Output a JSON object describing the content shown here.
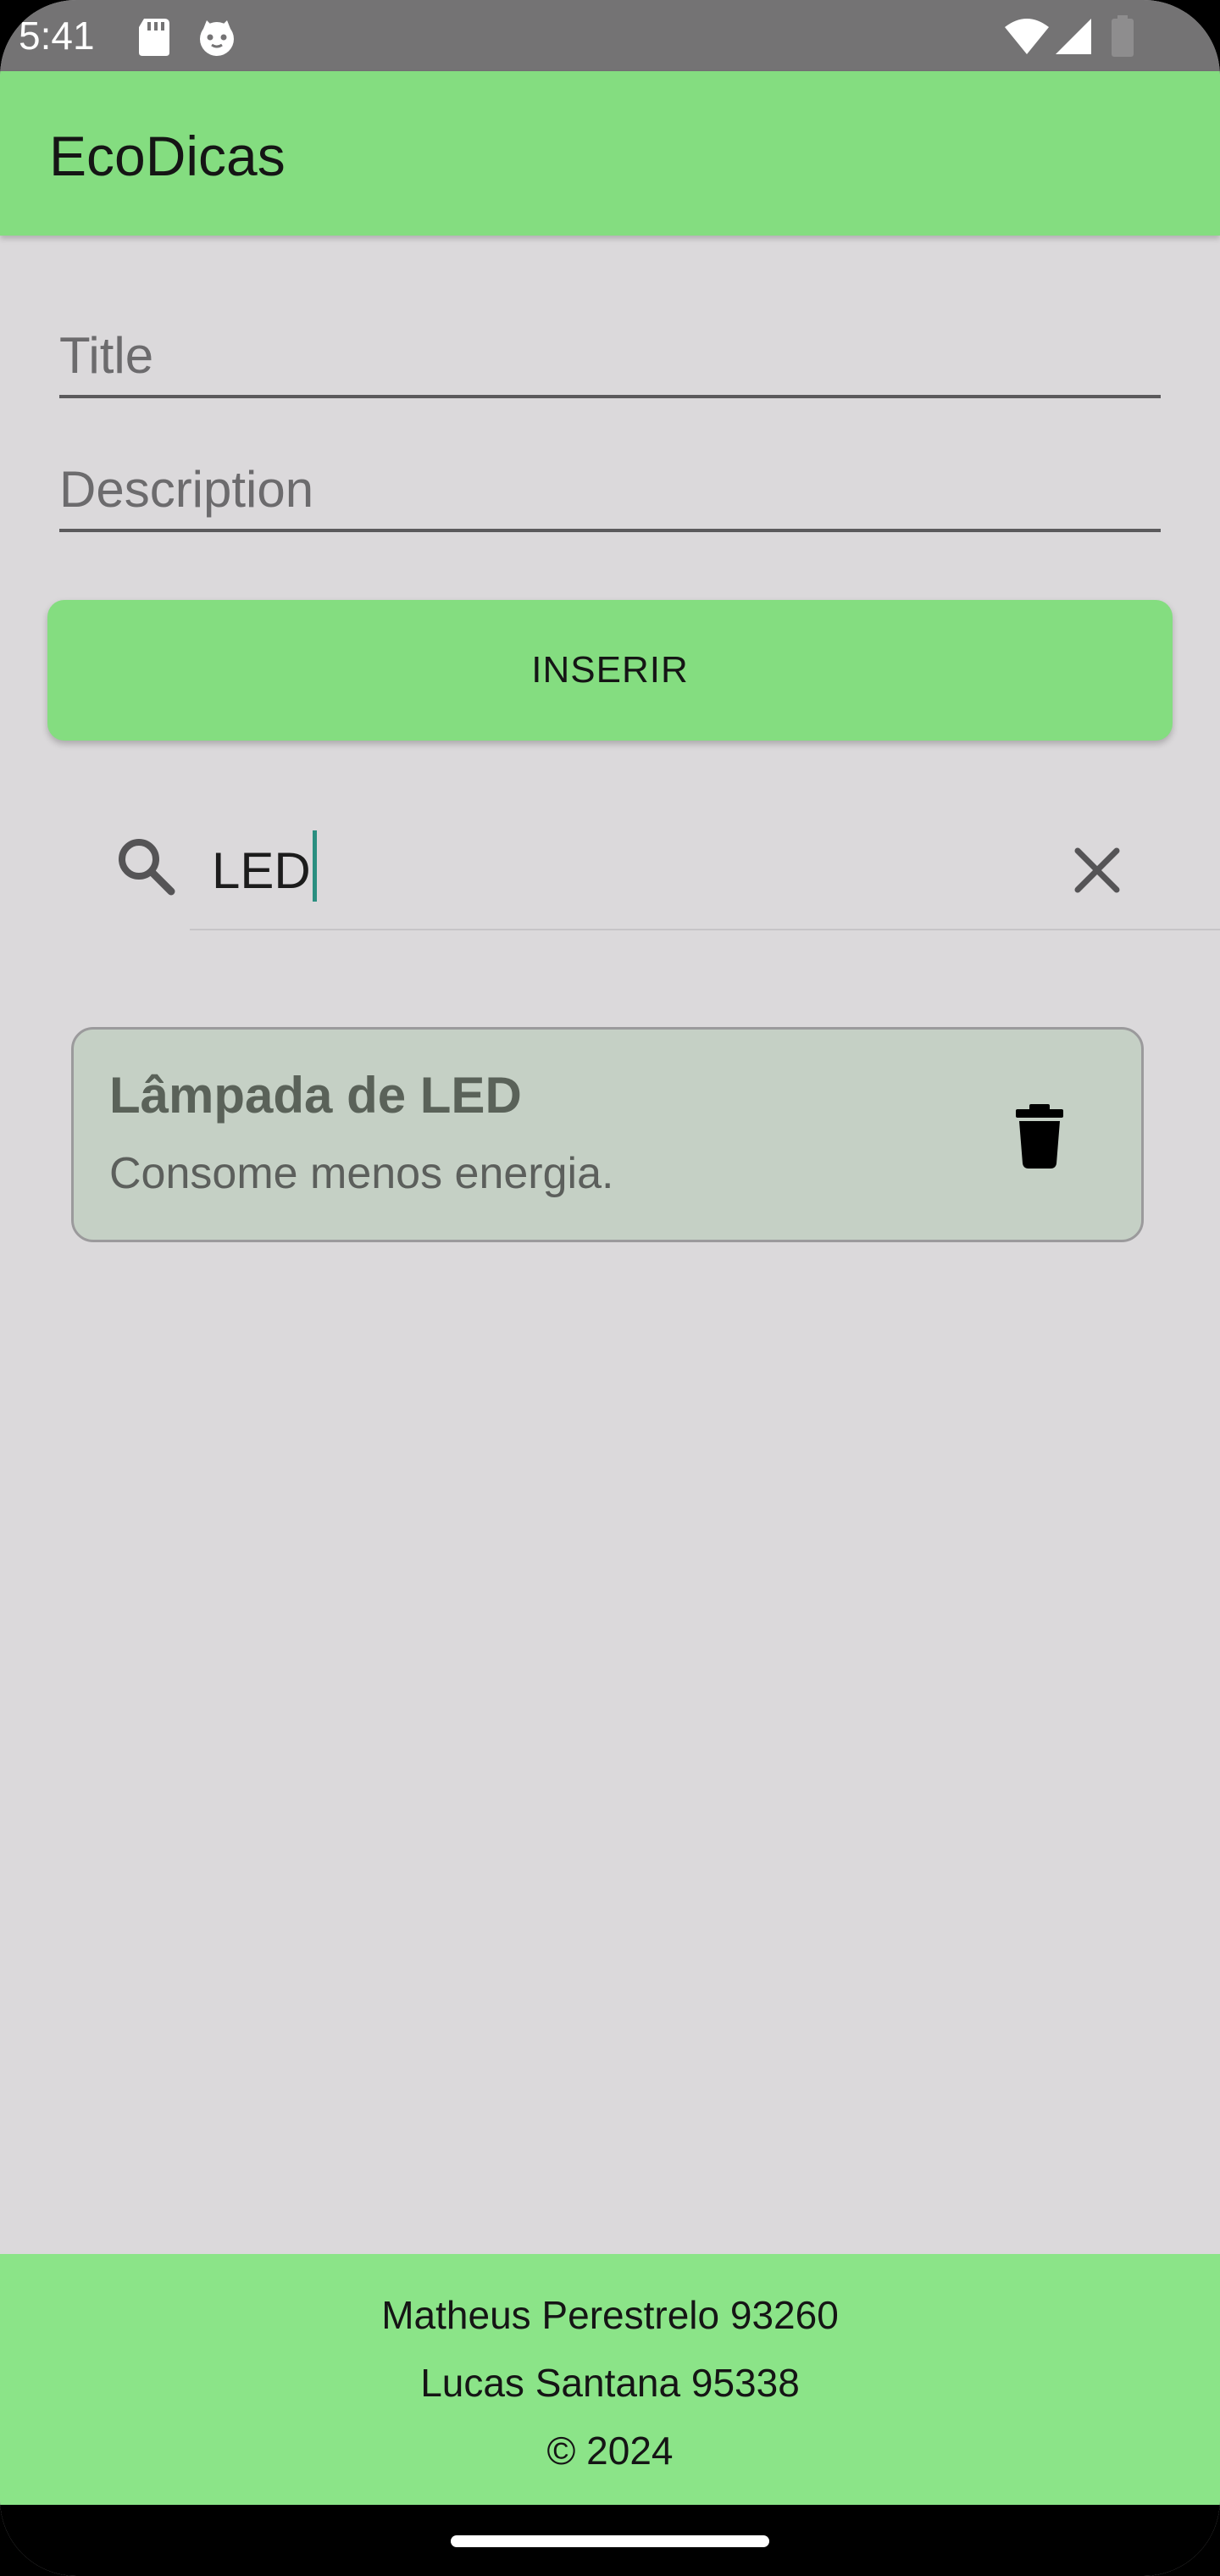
{
  "status_bar": {
    "time": "5:41"
  },
  "app_bar": {
    "title": "EcoDicas"
  },
  "form": {
    "title_placeholder": "Title",
    "description_placeholder": "Description",
    "insert_label": "INSERIR"
  },
  "search": {
    "query": "LED"
  },
  "tips": [
    {
      "title": "Lâmpada de LED",
      "description": "Consome menos energia."
    }
  ],
  "footer": {
    "line1": "Matheus Perestrelo 93260",
    "line2": "Lucas Santana 95338",
    "line3": "© 2024"
  },
  "colors": {
    "primary_green": "#84dd80",
    "footer_green": "#8be488",
    "background": "#dbd9db",
    "card_background": "#c5d0c5",
    "status_bar": "#747374",
    "caret": "#2a8f80"
  },
  "icons": {
    "sd_card": "sd-card-icon",
    "notification_app": "cat-face-icon",
    "wifi": "wifi-icon",
    "signal": "signal-icon",
    "battery": "battery-icon",
    "search": "search-icon",
    "clear": "close-icon",
    "delete": "trash-icon"
  }
}
